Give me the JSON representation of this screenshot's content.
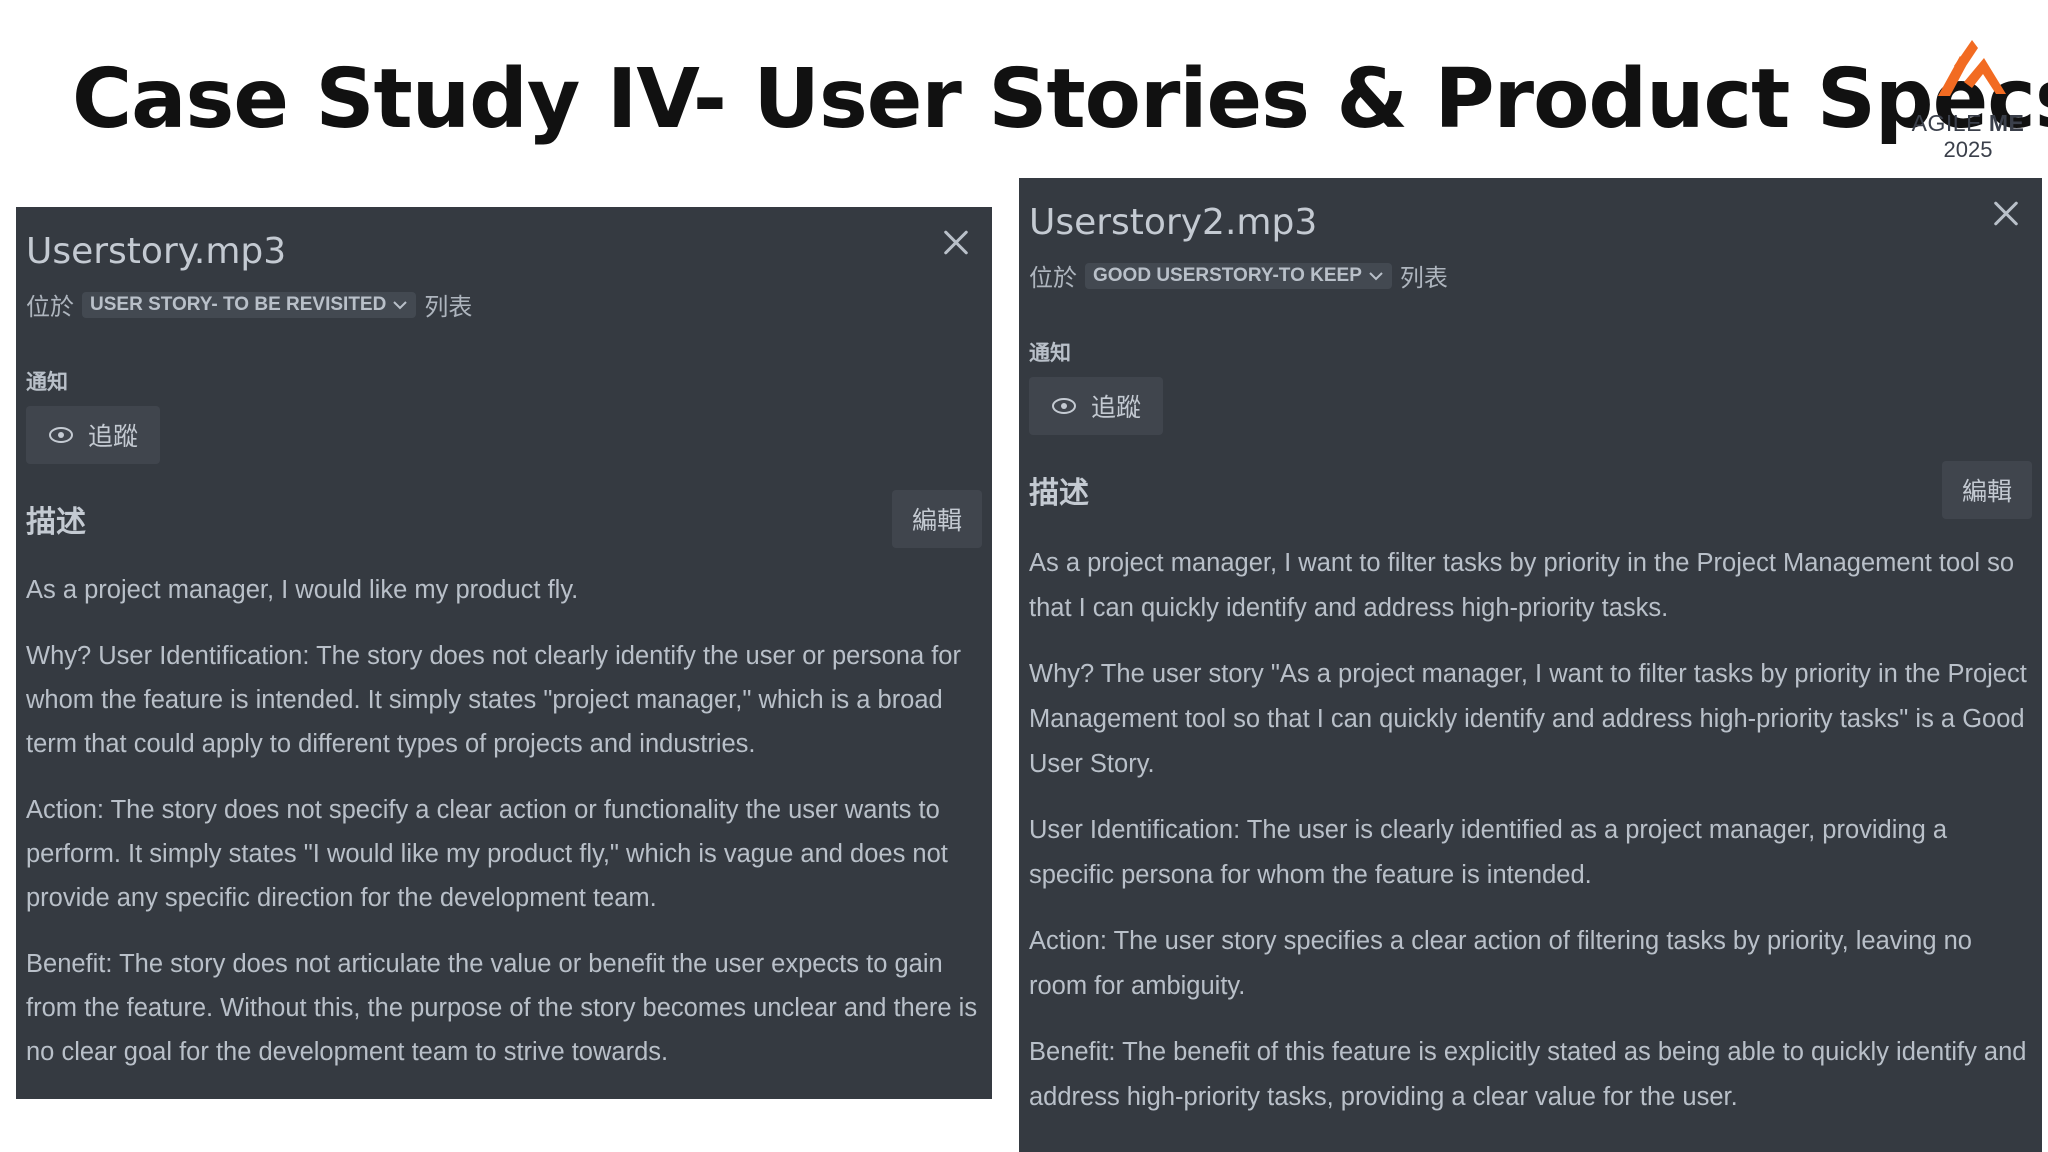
{
  "slide": {
    "title": "Case Study IV- User Stories & Product Specs",
    "logo": {
      "name": "AGILE",
      "name_bold": "ME",
      "year": "2025",
      "accent_color": "#f26b22"
    }
  },
  "cards": [
    {
      "file_name": "Userstory.mp3",
      "location_prefix": "位於",
      "list_name": "USER STORY- TO BE REVISITED",
      "location_suffix": "列表",
      "notifications_label": "通知",
      "watch_label": "追蹤",
      "description_label": "描述",
      "edit_label": "編輯",
      "paragraphs": [
        "As a project manager, I would like my product fly.",
        "Why? User Identification: The story does not clearly identify the user or persona for whom the feature is intended. It simply states \"project manager,\" which is a broad term that could apply to different types of projects and industries.",
        "Action: The story does not specify a clear action or functionality the user wants to perform. It simply states \"I would like my product fly,\" which is vague and does not provide any specific direction for the development team.",
        "Benefit: The story does not articulate the value or benefit the user expects to gain from the feature. Without this, the purpose of the story becomes unclear and there is no clear goal for the development team to strive towards."
      ]
    },
    {
      "file_name": "Userstory2.mp3",
      "location_prefix": "位於",
      "list_name": "GOOD USERSTORY-TO KEEP",
      "location_suffix": "列表",
      "notifications_label": "通知",
      "watch_label": "追蹤",
      "description_label": "描述",
      "edit_label": "編輯",
      "paragraphs": [
        "As a project manager, I want to filter tasks by priority in the Project Management tool so that I can quickly identify and address high-priority tasks.",
        "Why? The user story \"As a project manager, I want to filter tasks by priority in the Project Management tool so that I can quickly identify and address high-priority tasks\" is a Good User Story.",
        "User Identification: The user is clearly identified as a project manager, providing a specific persona for whom the feature is intended.",
        "Action: The user story specifies a clear action of filtering tasks by priority, leaving no room for ambiguity.",
        "Benefit: The benefit of this feature is explicitly stated as being able to quickly identify and address high-priority tasks, providing a clear value for the user."
      ]
    }
  ]
}
